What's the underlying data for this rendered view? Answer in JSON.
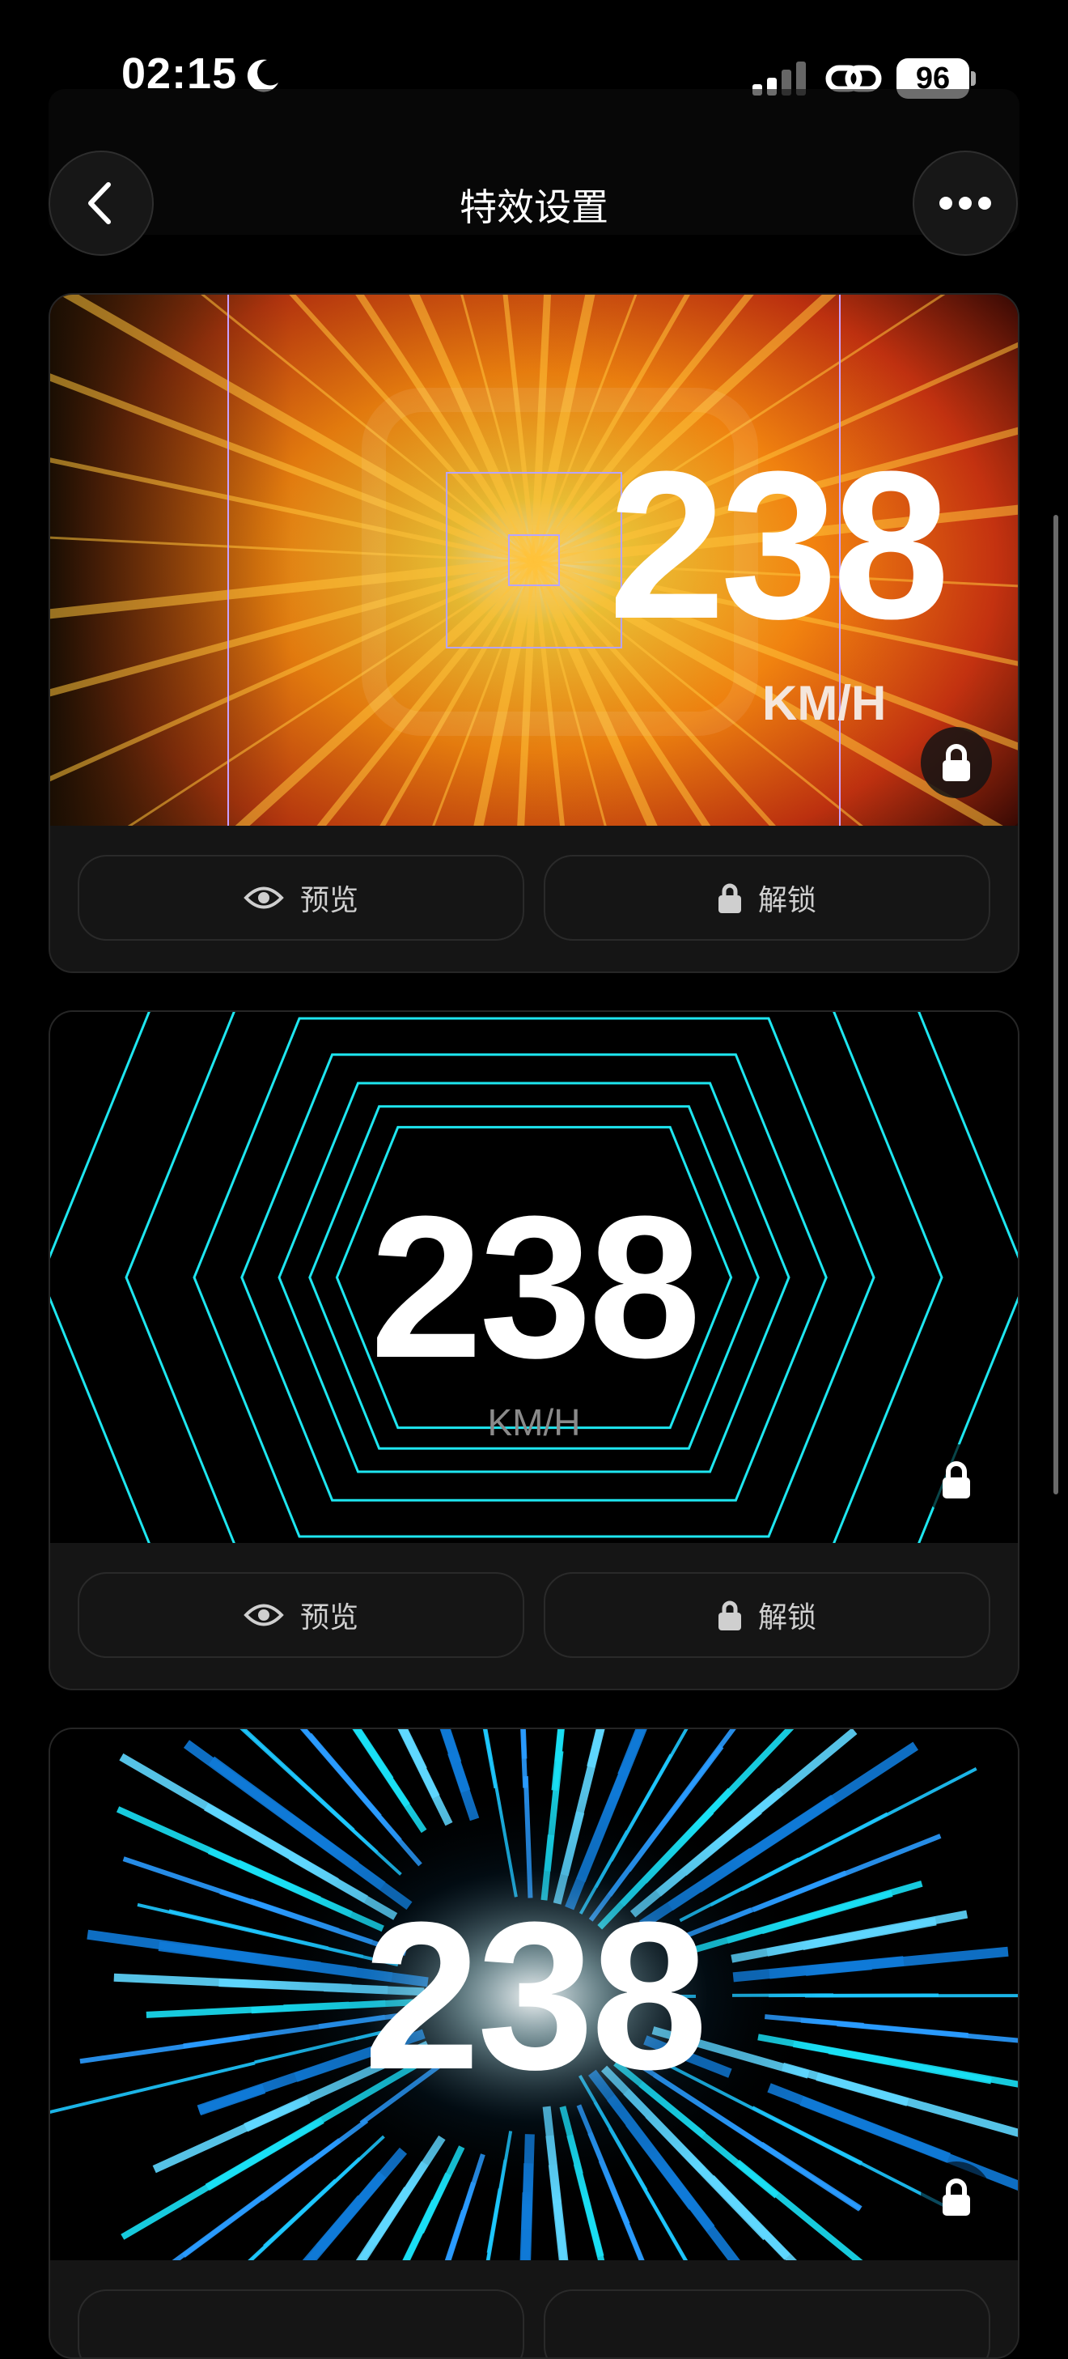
{
  "status_bar": {
    "time": "02:15",
    "battery": "96"
  },
  "header": {
    "title": "特效设置"
  },
  "effects": [
    {
      "speed": "238",
      "unit": "KM/H",
      "preview_label": "预览",
      "unlock_label": "解锁",
      "accent": "#ff8a1a"
    },
    {
      "speed": "238",
      "unit": "KM/H",
      "preview_label": "预览",
      "unlock_label": "解锁",
      "accent": "#1ee6f0"
    },
    {
      "speed": "238",
      "accent": "#2ab6ff"
    }
  ]
}
